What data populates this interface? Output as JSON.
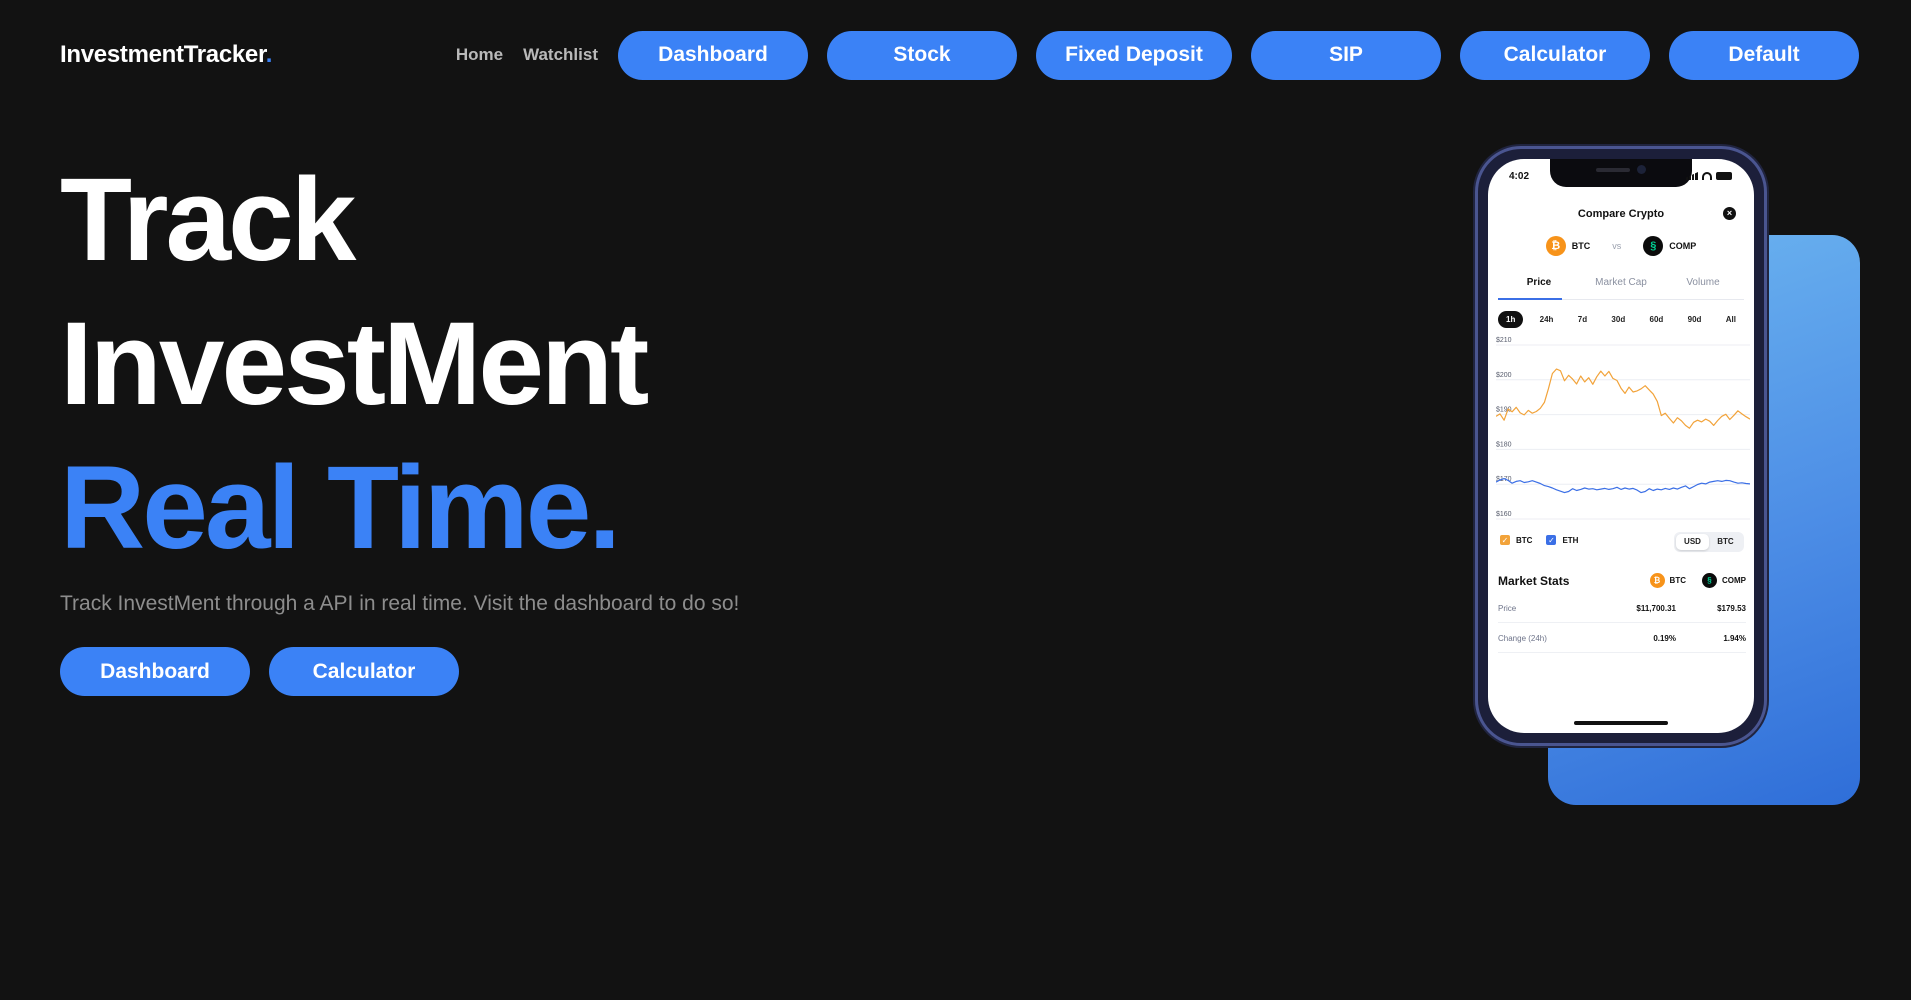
{
  "nav": {
    "logo_text": "InvestmentTracker",
    "logo_dot": ".",
    "links": [
      "Home",
      "Watchlist"
    ],
    "buttons": [
      "Dashboard",
      "Stock",
      "Fixed Deposit",
      "SIP",
      "Calculator",
      "Default"
    ]
  },
  "hero": {
    "line1": "Track",
    "line2": "InvestMent",
    "line3": "Real Time.",
    "subtitle": "Track InvestMent through a API in real time. Visit the dashboard to do so!",
    "buttons": [
      "Dashboard",
      "Calculator"
    ]
  },
  "phone": {
    "time": "4:02",
    "title": "Compare Crypto",
    "close_glyph": "×",
    "coin_a": "BTC",
    "vs": "vs",
    "coin_b": "COMP",
    "tabs": [
      "Price",
      "Market Cap",
      "Volume"
    ],
    "ranges": [
      "1h",
      "24h",
      "7d",
      "30d",
      "60d",
      "90d",
      "All"
    ],
    "legend": [
      "BTC",
      "ETH"
    ],
    "currency_toggle": [
      "USD",
      "BTC"
    ],
    "market_stats_title": "Market Stats",
    "stats": [
      {
        "label": "Price",
        "btc": "$11,700.31",
        "comp": "$179.53"
      },
      {
        "label": "Change (24h)",
        "btc": "0.19%",
        "comp": "1.94%"
      }
    ]
  },
  "chart_data": {
    "type": "line",
    "y_ticks": [
      "$210",
      "$200",
      "$190",
      "$180",
      "$170",
      "$160"
    ],
    "ylim": [
      160,
      210
    ],
    "series": [
      {
        "name": "BTC",
        "color": "#f2a33a",
        "values": [
          189.5,
          190.2,
          188.4,
          191.6,
          190.8,
          192.1,
          190.5,
          189.9,
          191.2,
          190.4,
          190.9,
          191.8,
          193.5,
          197.4,
          201.8,
          203.1,
          202.6,
          199.7,
          201.3,
          200.2,
          198.8,
          201.1,
          199.4,
          200.6,
          198.7,
          200.9,
          202.5,
          201.1,
          202.4,
          200.4,
          199.8,
          197.6,
          196.1,
          197.9,
          196.5,
          196.8,
          197.4,
          198.3,
          197.1,
          195.9,
          193.8,
          189.7,
          190.4,
          188.9,
          187.6,
          189.1,
          188.2,
          186.9,
          186.1,
          187.8,
          188.4,
          187.9,
          188.7,
          188.1,
          186.9,
          188.3,
          189.5,
          190.1,
          188.6,
          189.8,
          191.1,
          190.2,
          189.4,
          188.7
        ]
      },
      {
        "name": "ETH",
        "color": "#3b6fe6",
        "values": [
          170.6,
          171.2,
          171.6,
          171.1,
          170.3,
          170.8,
          171.0,
          170.5,
          170.7,
          171.0,
          170.6,
          170.2,
          169.6,
          169.3,
          168.9,
          168.4,
          168.0,
          167.6,
          167.9,
          168.7,
          168.2,
          168.5,
          168.9,
          168.6,
          168.7,
          168.4,
          168.6,
          168.8,
          168.5,
          168.7,
          169.1,
          168.5,
          168.9,
          168.6,
          168.8,
          168.3,
          167.6,
          167.9,
          168.7,
          168.2,
          168.6,
          168.4,
          168.8,
          168.5,
          168.9,
          168.6,
          169.1,
          169.5,
          168.7,
          169.3,
          169.9,
          170.3,
          170.1,
          170.6,
          170.8,
          171.0,
          170.8,
          171.1,
          171.0,
          170.6,
          170.3,
          170.4,
          170.2,
          170.1
        ]
      }
    ]
  }
}
